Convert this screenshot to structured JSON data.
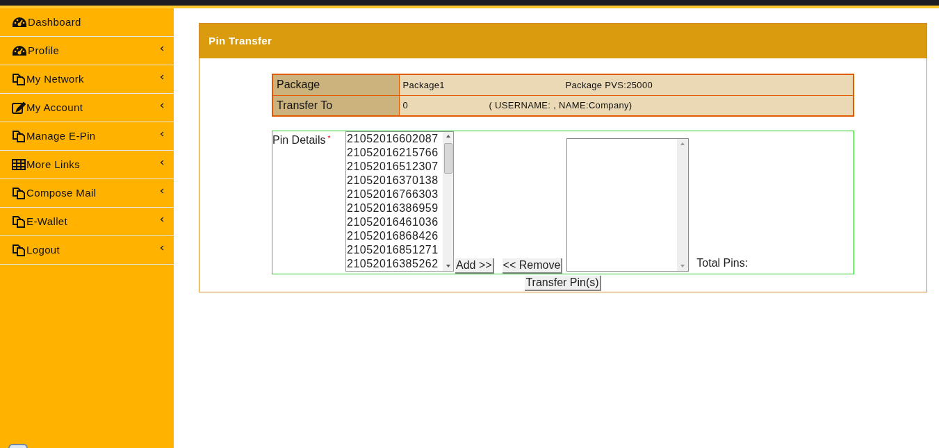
{
  "sidebar": {
    "items": [
      {
        "label": "Dashboard",
        "kind": "gauge",
        "has_submenu": false
      },
      {
        "label": "Profile",
        "kind": "gauge",
        "has_submenu": true
      },
      {
        "label": "My Network",
        "kind": "copy",
        "has_submenu": true
      },
      {
        "label": "My Account",
        "kind": "edit",
        "has_submenu": true
      },
      {
        "label": "Manage E-Pin",
        "kind": "copy",
        "has_submenu": true
      },
      {
        "label": "More Links",
        "kind": "grid",
        "has_submenu": true
      },
      {
        "label": "Compose Mail",
        "kind": "copy",
        "has_submenu": true
      },
      {
        "label": "E-Wallet",
        "kind": "copy",
        "has_submenu": true
      },
      {
        "label": "Logout",
        "kind": "copy",
        "has_submenu": true
      }
    ]
  },
  "panel": {
    "title": "Pin Transfer",
    "info_rows": [
      {
        "label": "Package",
        "value": "Package1",
        "extra": "Package PVS:25000"
      },
      {
        "label": "Transfer To",
        "value": "0",
        "extra": "( USERNAME: , NAME:Company)"
      }
    ],
    "pin_details": {
      "label": "Pin Details",
      "required_mark": "*",
      "available_pins": [
        "21052016602087",
        "21052016215766",
        "21052016512307",
        "21052016370138",
        "21052016766303",
        "21052016386959",
        "21052016461036",
        "21052016868426",
        "21052016851271",
        "21052016385262"
      ],
      "add_button": "Add >>",
      "remove_button": "<< Remove",
      "total_label": "Total Pins:"
    },
    "submit_button": "Transfer Pin(s)"
  }
}
